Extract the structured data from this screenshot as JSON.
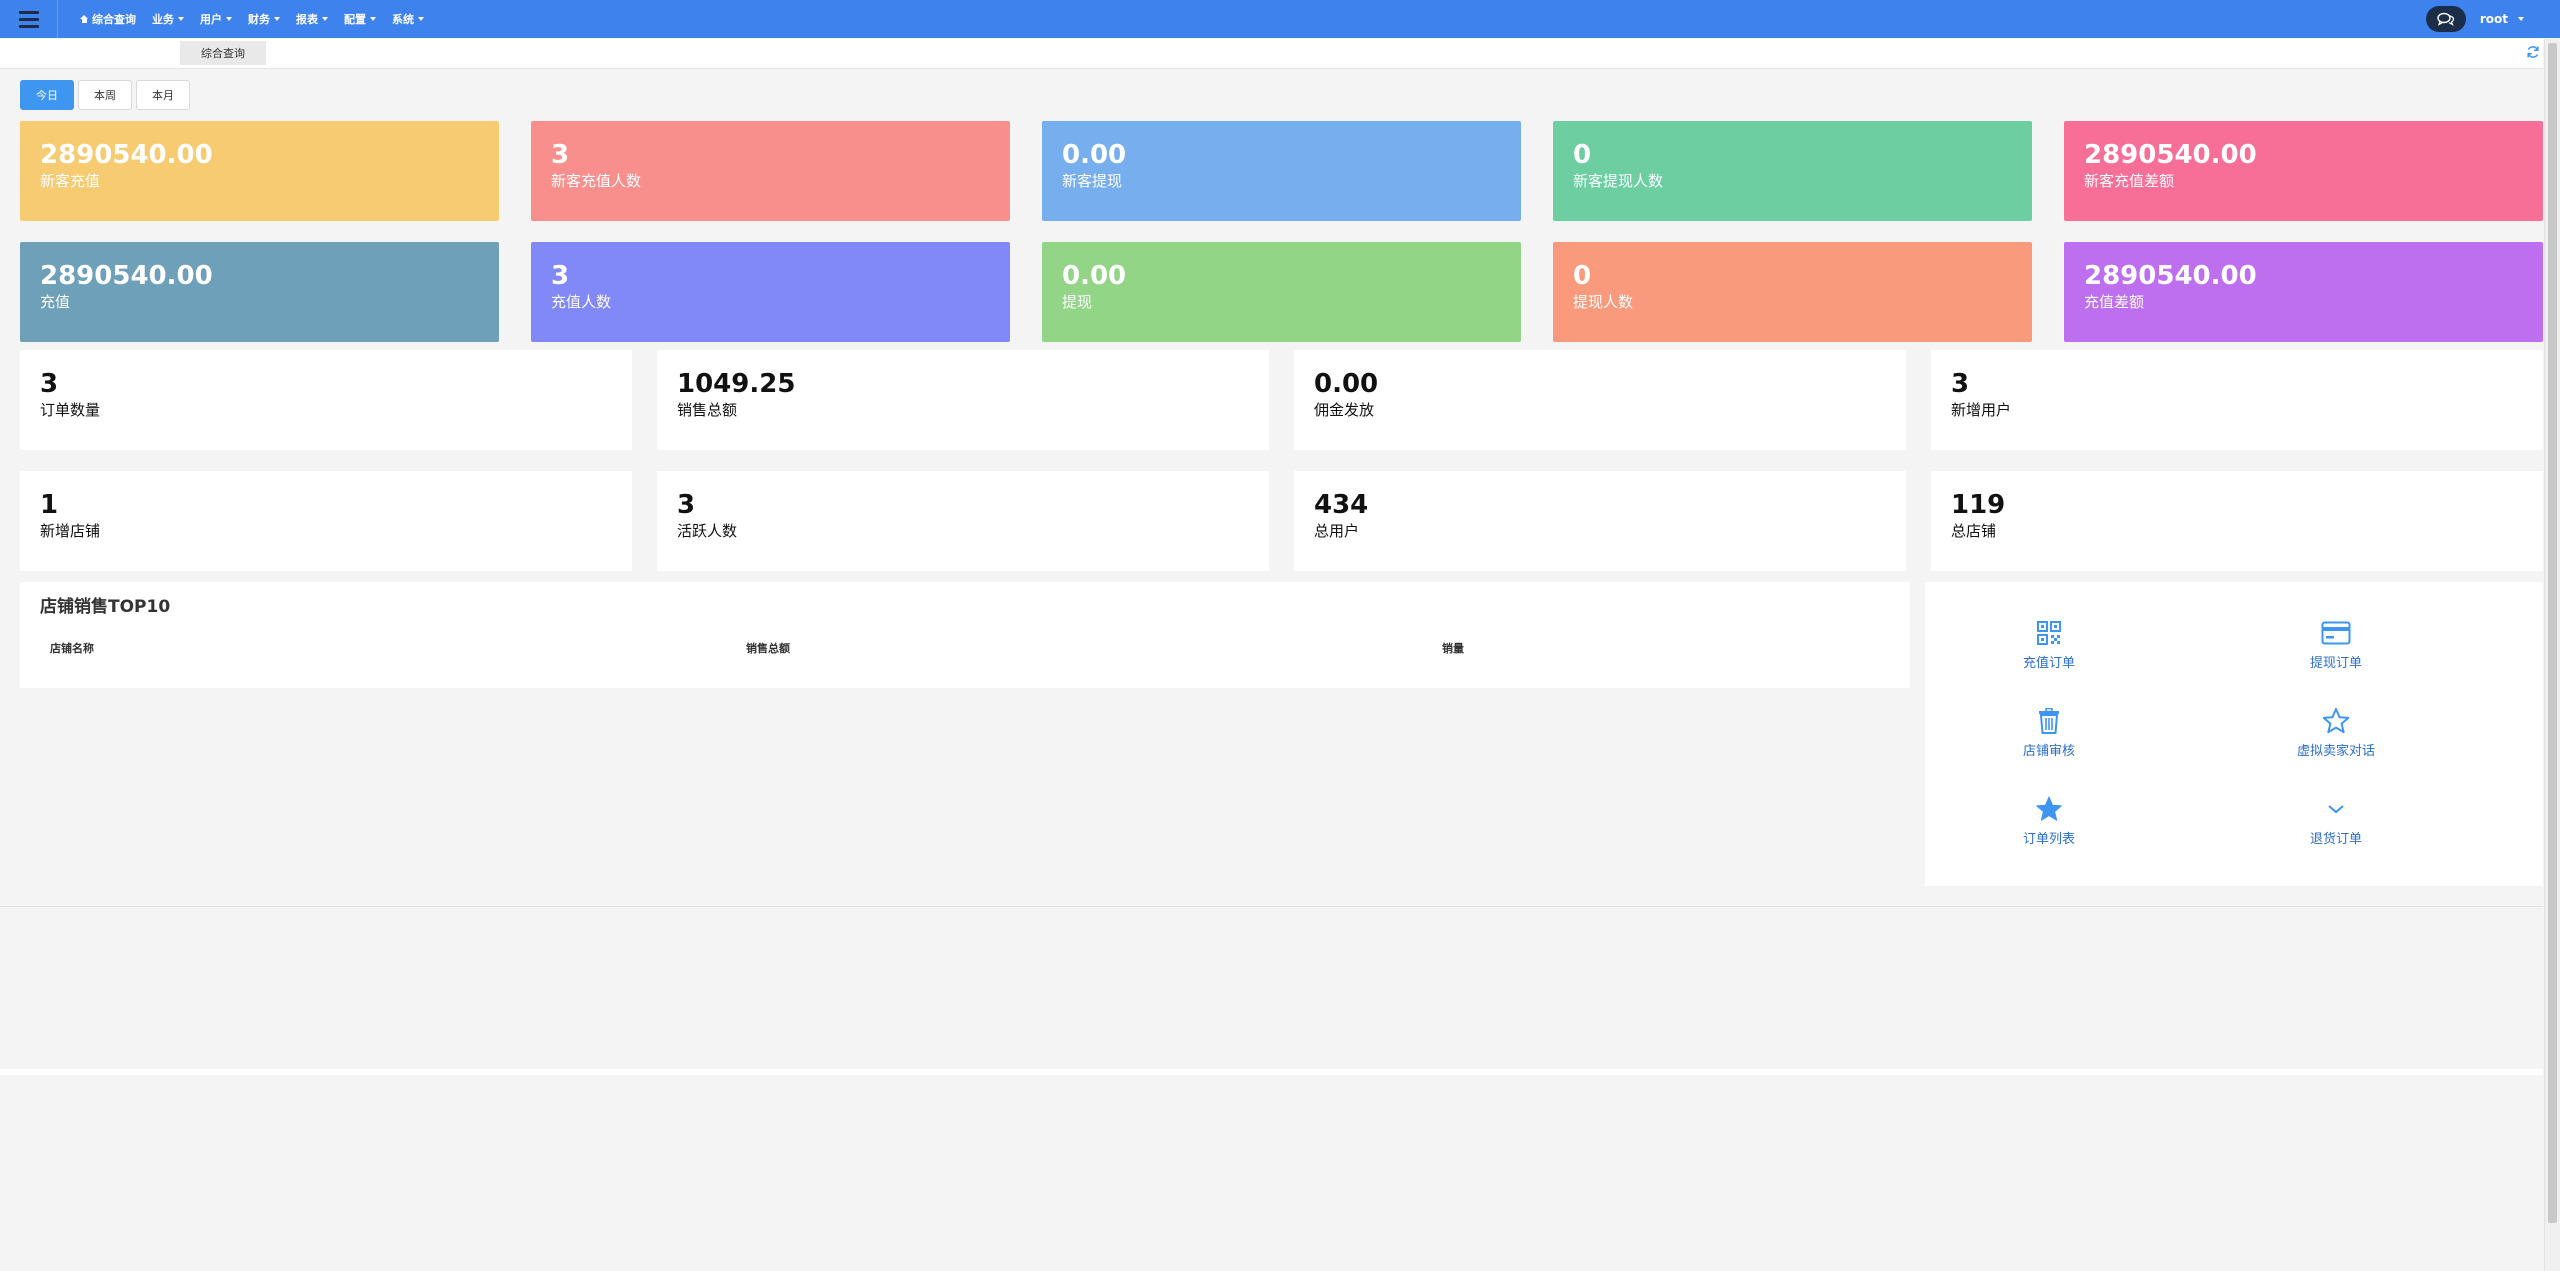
{
  "nav": {
    "items": [
      {
        "label": "综合查询",
        "icon": "home-icon",
        "caret": false
      },
      {
        "label": "业务",
        "caret": true
      },
      {
        "label": "用户",
        "caret": true
      },
      {
        "label": "财务",
        "caret": true
      },
      {
        "label": "报表",
        "caret": true
      },
      {
        "label": "配置",
        "caret": true
      },
      {
        "label": "系统",
        "caret": true
      }
    ],
    "user": "root"
  },
  "tabs": {
    "active": "综合查询"
  },
  "period": {
    "buttons": [
      "今日",
      "本周",
      "本月"
    ],
    "active": "今日"
  },
  "color_cards": [
    {
      "value": "2890540.00",
      "label": "新客充值",
      "color": "#f6cb72"
    },
    {
      "value": "3",
      "label": "新客充值人数",
      "color": "#f98f8d"
    },
    {
      "value": "0.00",
      "label": "新客提现",
      "color": "#77aeee"
    },
    {
      "value": "0",
      "label": "新客提现人数",
      "color": "#6dcea2"
    },
    {
      "value": "2890540.00",
      "label": "新客充值差额",
      "color": "#f76f96"
    },
    {
      "value": "2890540.00",
      "label": "充值",
      "color": "#6ea0ba"
    },
    {
      "value": "3",
      "label": "充值人数",
      "color": "#8188f7"
    },
    {
      "value": "0.00",
      "label": "提现",
      "color": "#92d586"
    },
    {
      "value": "0",
      "label": "提现人数",
      "color": "#f99a7c"
    },
    {
      "value": "2890540.00",
      "label": "充值差额",
      "color": "#be6ff0"
    }
  ],
  "white_cards": [
    {
      "value": "3",
      "label": "订单数量"
    },
    {
      "value": "1049.25",
      "label": "销售总额"
    },
    {
      "value": "0.00",
      "label": "佣金发放"
    },
    {
      "value": "3",
      "label": "新增用户"
    },
    {
      "value": "1",
      "label": "新增店铺"
    },
    {
      "value": "3",
      "label": "活跃人数"
    },
    {
      "value": "434",
      "label": "总用户"
    },
    {
      "value": "119",
      "label": "总店铺"
    }
  ],
  "top10": {
    "title": "店铺销售TOP10",
    "columns": [
      "店铺名称",
      "销售总额",
      "销量"
    ]
  },
  "quick_links": [
    {
      "label": "充值订单",
      "icon": "qrcode-icon"
    },
    {
      "label": "提现订单",
      "icon": "credit-card-icon"
    },
    {
      "label": "店铺审核",
      "icon": "trash-icon"
    },
    {
      "label": "虚拟卖家对话",
      "icon": "star-outline-icon"
    },
    {
      "label": "订单列表",
      "icon": "star-filled-icon"
    },
    {
      "label": "退货订单",
      "icon": "chevron-down-icon"
    }
  ],
  "colors": {
    "navbar": "#3e82ee",
    "accent": "#3e96f0",
    "link": "#2a6fc9"
  }
}
